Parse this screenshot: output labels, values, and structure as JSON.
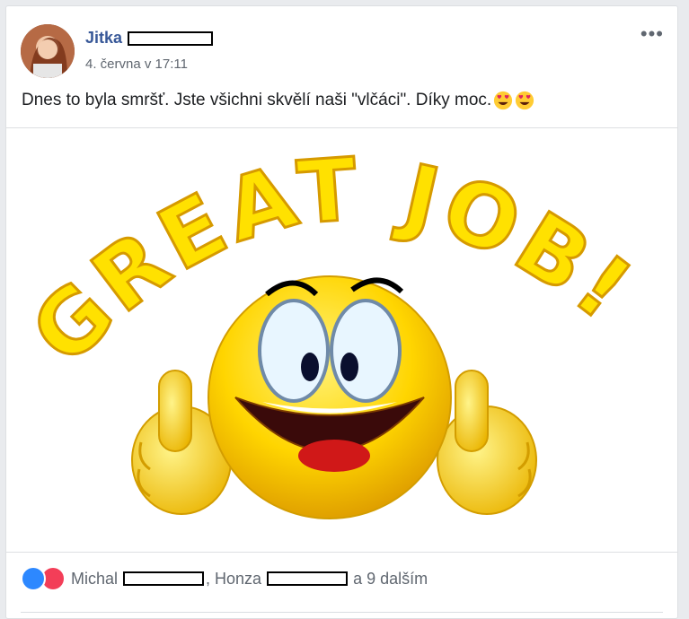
{
  "post": {
    "author": "Jitka",
    "timestamp": "4. června v 17:11",
    "text": "Dnes to byla smršť. Jste všichni skvělí naši \"vlčáci\". Díky moc.",
    "emojis": [
      "heart-eyes-emoji",
      "heart-eyes-emoji"
    ],
    "image": {
      "headline": "GREAT JOB!",
      "alt": "smiley thumbs up"
    },
    "reactions": {
      "icons": [
        "like-icon",
        "love-icon"
      ],
      "name1": "Michal",
      "separator": ", Honza",
      "suffix": "a 9 dalším"
    }
  },
  "colors": {
    "link": "#385898",
    "secondary": "#606770",
    "like": "#2d88ff",
    "love": "#f33e58",
    "yellow": "#ffd500"
  }
}
